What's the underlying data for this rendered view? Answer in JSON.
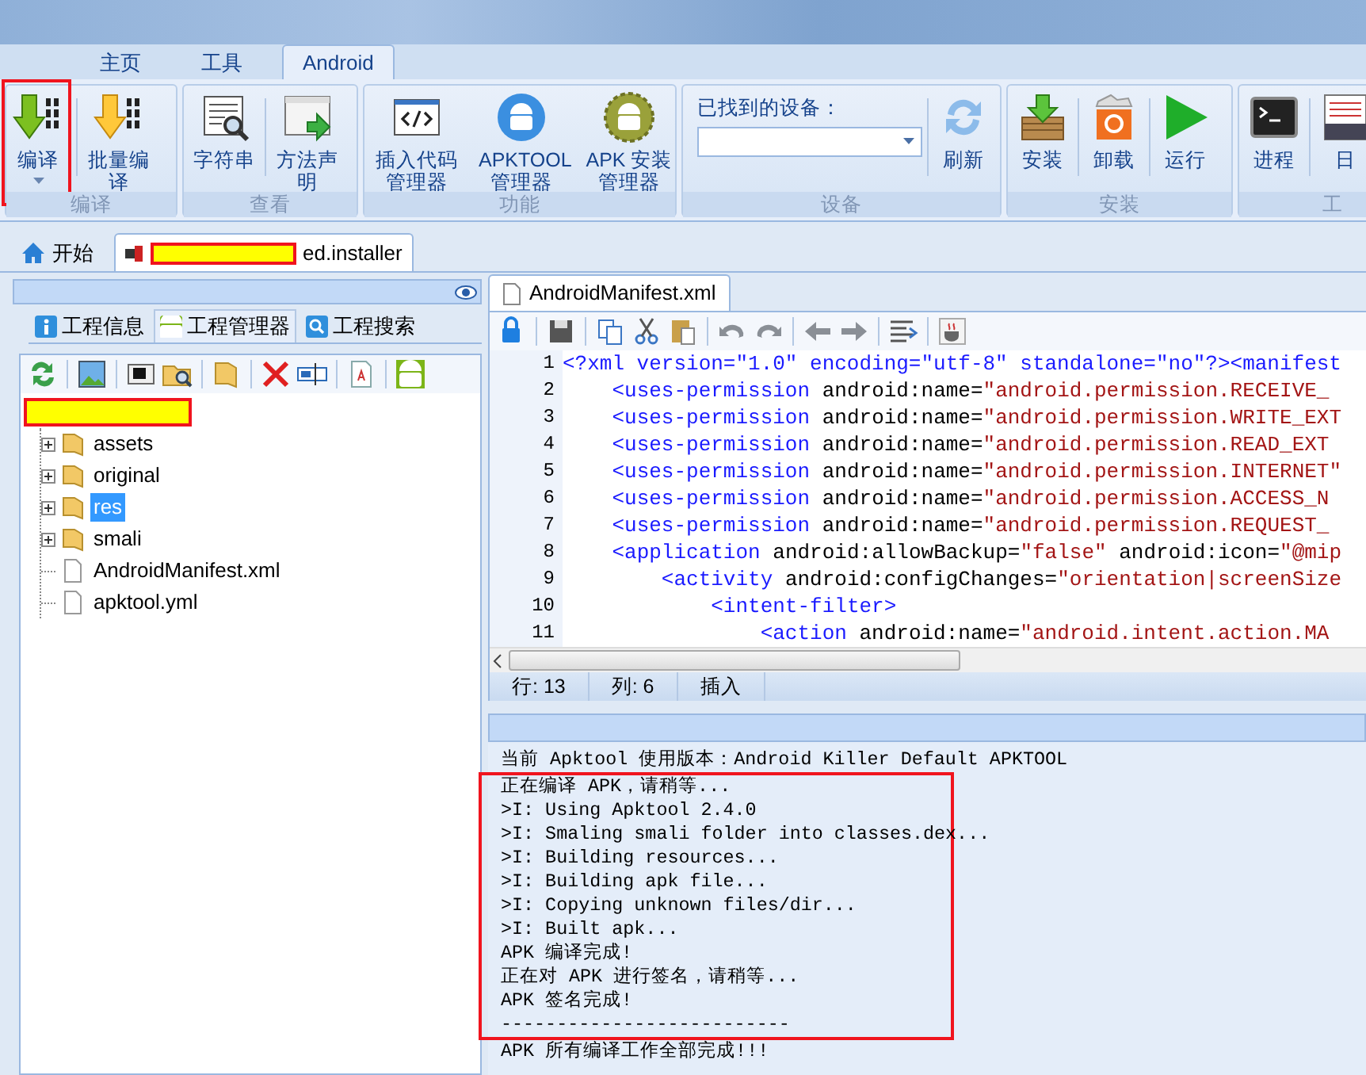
{
  "ribbon": {
    "tabs": [
      {
        "label": "主页",
        "selected": false
      },
      {
        "label": "工具",
        "selected": false
      },
      {
        "label": "Android",
        "selected": true
      }
    ],
    "groups": [
      {
        "label": "编译",
        "items": [
          {
            "kind": "button",
            "label": "编译",
            "dropdown": true,
            "annotated": true
          },
          {
            "kind": "button",
            "label": "批量编译",
            "dropdown": false,
            "annotated": false
          }
        ]
      },
      {
        "label": "查看",
        "items": [
          {
            "kind": "button",
            "label": "字符串",
            "dropdown": false,
            "annotated": false
          },
          {
            "kind": "button",
            "label": "方法声明",
            "dropdown": false,
            "annotated": false
          }
        ]
      },
      {
        "label": "功能",
        "items": [
          {
            "kind": "button",
            "label": "插入代码管理器",
            "dropdown": false,
            "annotated": false
          },
          {
            "kind": "button",
            "label": "APKTOOL 管理器",
            "dropdown": false,
            "annotated": false
          },
          {
            "kind": "button",
            "label": "APK 安装管理器",
            "dropdown": false,
            "annotated": false
          }
        ]
      },
      {
        "label": "设备",
        "items": [
          {
            "kind": "combo",
            "label": "已找到的设备："
          },
          {
            "kind": "button",
            "label": "刷新",
            "dropdown": false,
            "annotated": false
          }
        ]
      },
      {
        "label": "安装",
        "items": [
          {
            "kind": "button",
            "label": "安装",
            "dropdown": false,
            "annotated": false
          },
          {
            "kind": "button",
            "label": "卸载",
            "dropdown": false,
            "annotated": false
          },
          {
            "kind": "button",
            "label": "运行",
            "dropdown": false,
            "annotated": false
          }
        ]
      },
      {
        "label": "工",
        "items": [
          {
            "kind": "button",
            "label": "进程",
            "dropdown": false,
            "annotated": false
          },
          {
            "kind": "button",
            "label": "日",
            "dropdown": false,
            "annotated": false
          }
        ]
      }
    ]
  },
  "document_tabs": [
    {
      "kind": "home",
      "label": "开始",
      "selected": false,
      "redacted": false
    },
    {
      "kind": "project",
      "label": "ed.installer",
      "selected": true,
      "redacted": true
    }
  ],
  "project_panel": {
    "tabs": [
      {
        "label": "工程信息",
        "selected": false
      },
      {
        "label": "工程管理器",
        "selected": true
      },
      {
        "label": "工程搜索",
        "selected": false
      }
    ],
    "tree": [
      {
        "kind": "redacted",
        "children": [
          {
            "kind": "folder",
            "label": "assets",
            "expanded": false,
            "selected": false
          },
          {
            "kind": "folder",
            "label": "original",
            "expanded": false,
            "selected": false
          },
          {
            "kind": "folder",
            "label": "res",
            "expanded": false,
            "selected": true
          },
          {
            "kind": "folder",
            "label": "smali",
            "expanded": false,
            "selected": false
          },
          {
            "kind": "file",
            "label": "AndroidManifest.xml",
            "selected": false
          },
          {
            "kind": "file",
            "label": "apktool.yml",
            "selected": false
          }
        ]
      }
    ]
  },
  "editor": {
    "tab": {
      "label": "AndroidManifest.xml",
      "selected": true
    },
    "lines": [
      {
        "number": "1",
        "kind": "pi",
        "text": "<?xml version=\"1.0\" encoding=\"utf-8\" standalone=\"no\"?><manifest"
      },
      {
        "number": "2",
        "kind": "element",
        "text": "    <uses-permission android:name=\"android.permission.RECEIVE_"
      },
      {
        "number": "3",
        "kind": "element",
        "text": "    <uses-permission android:name=\"android.permission.WRITE_EXT"
      },
      {
        "number": "4",
        "kind": "element",
        "text": "    <uses-permission android:name=\"android.permission.READ_EXT"
      },
      {
        "number": "5",
        "kind": "element",
        "text": "    <uses-permission android:name=\"android.permission.INTERNET\""
      },
      {
        "number": "6",
        "kind": "element",
        "text": "    <uses-permission android:name=\"android.permission.ACCESS_N"
      },
      {
        "number": "7",
        "kind": "element",
        "text": "    <uses-permission android:name=\"android.permission.REQUEST_"
      },
      {
        "number": "8",
        "kind": "element",
        "text": "    <application android:allowBackup=\"false\" android:icon=\"@mip"
      },
      {
        "number": "9",
        "kind": "element",
        "text": "        <activity android:configChanges=\"orientation|screenSize"
      },
      {
        "number": "10",
        "kind": "element",
        "text": "            <intent-filter>"
      },
      {
        "number": "11",
        "kind": "element",
        "text": "                <action android:name=\"android.intent.action.MA"
      }
    ],
    "status": [
      "行: 13",
      "列: 6",
      "插入"
    ]
  },
  "output": {
    "blocks": [
      {
        "annotated": false,
        "lines": [
          "当前 Apktool 使用版本：Android Killer Default APKTOOL"
        ]
      },
      {
        "annotated": true,
        "lines": [
          "正在编译 APK，请稍等...",
          ">I: Using Apktool 2.4.0",
          ">I: Smaling smali folder into classes.dex...",
          ">I: Building resources...",
          ">I: Building apk file...",
          ">I: Copying unknown files/dir...",
          ">I: Built apk...",
          "APK 编译完成!",
          "正在对 APK 进行签名，请稍等...",
          "APK 签名完成!",
          "--------------------------"
        ]
      },
      {
        "annotated": false,
        "lines": [
          "APK 所有编译工作全部完成!!!"
        ]
      }
    ]
  }
}
